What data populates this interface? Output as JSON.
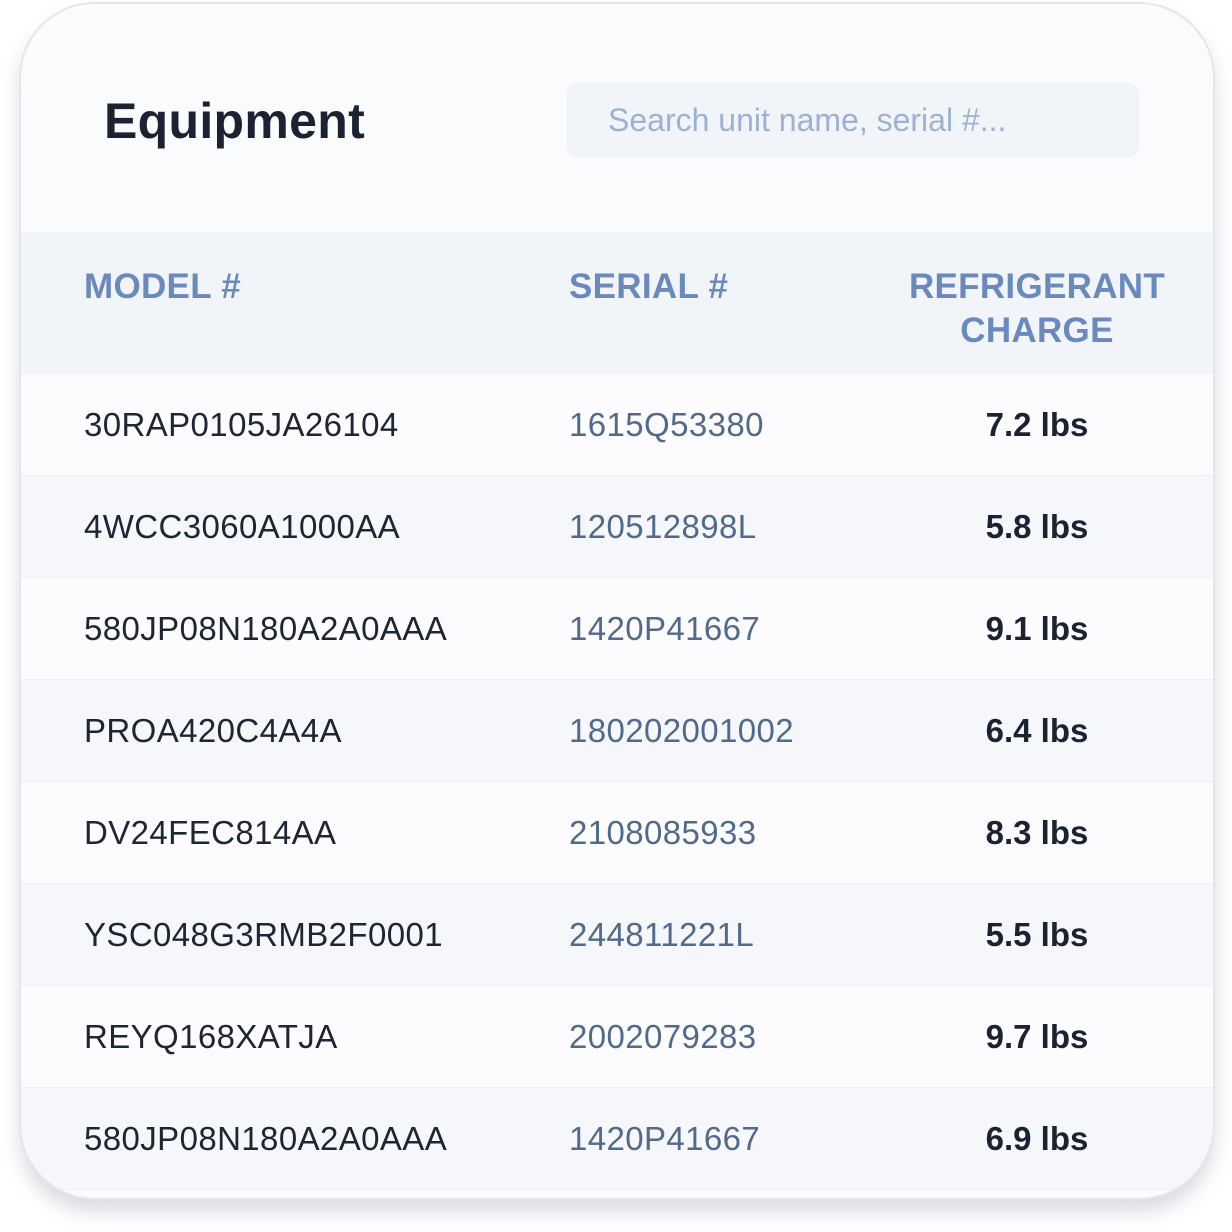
{
  "header": {
    "title": "Equipment",
    "search_placeholder": "Search unit name, serial #..."
  },
  "table": {
    "columns": {
      "model": "MODEL #",
      "serial": "SERIAL #",
      "charge_line1": "REFRIGERANT",
      "charge_line2": "CHARGE"
    },
    "rows": [
      {
        "model": "30RAP0105JA26104",
        "serial": "1615Q53380",
        "charge": "7.2 lbs"
      },
      {
        "model": "4WCC3060A1000AA",
        "serial": "120512898L",
        "charge": "5.8 lbs"
      },
      {
        "model": "580JP08N180A2A0AAA",
        "serial": "1420P41667",
        "charge": "9.1 lbs"
      },
      {
        "model": "PROA420C4A4A",
        "serial": "180202001002",
        "charge": "6.4 lbs"
      },
      {
        "model": "DV24FEC814AA",
        "serial": "2108085933",
        "charge": "8.3 lbs"
      },
      {
        "model": "YSC048G3RMB2F0001",
        "serial": "244811221L",
        "charge": "5.5 lbs"
      },
      {
        "model": "REYQ168XATJA",
        "serial": "2002079283",
        "charge": "9.7 lbs"
      },
      {
        "model": "580JP08N180A2A0AAA",
        "serial": "1420P41667",
        "charge": "6.9 lbs"
      }
    ]
  },
  "colors": {
    "title": "#1b2333",
    "header_text": "#6a89bc",
    "serial_text": "#516a8b",
    "placeholder": "#9db2d2",
    "header_bg": "#f1f4f9"
  }
}
